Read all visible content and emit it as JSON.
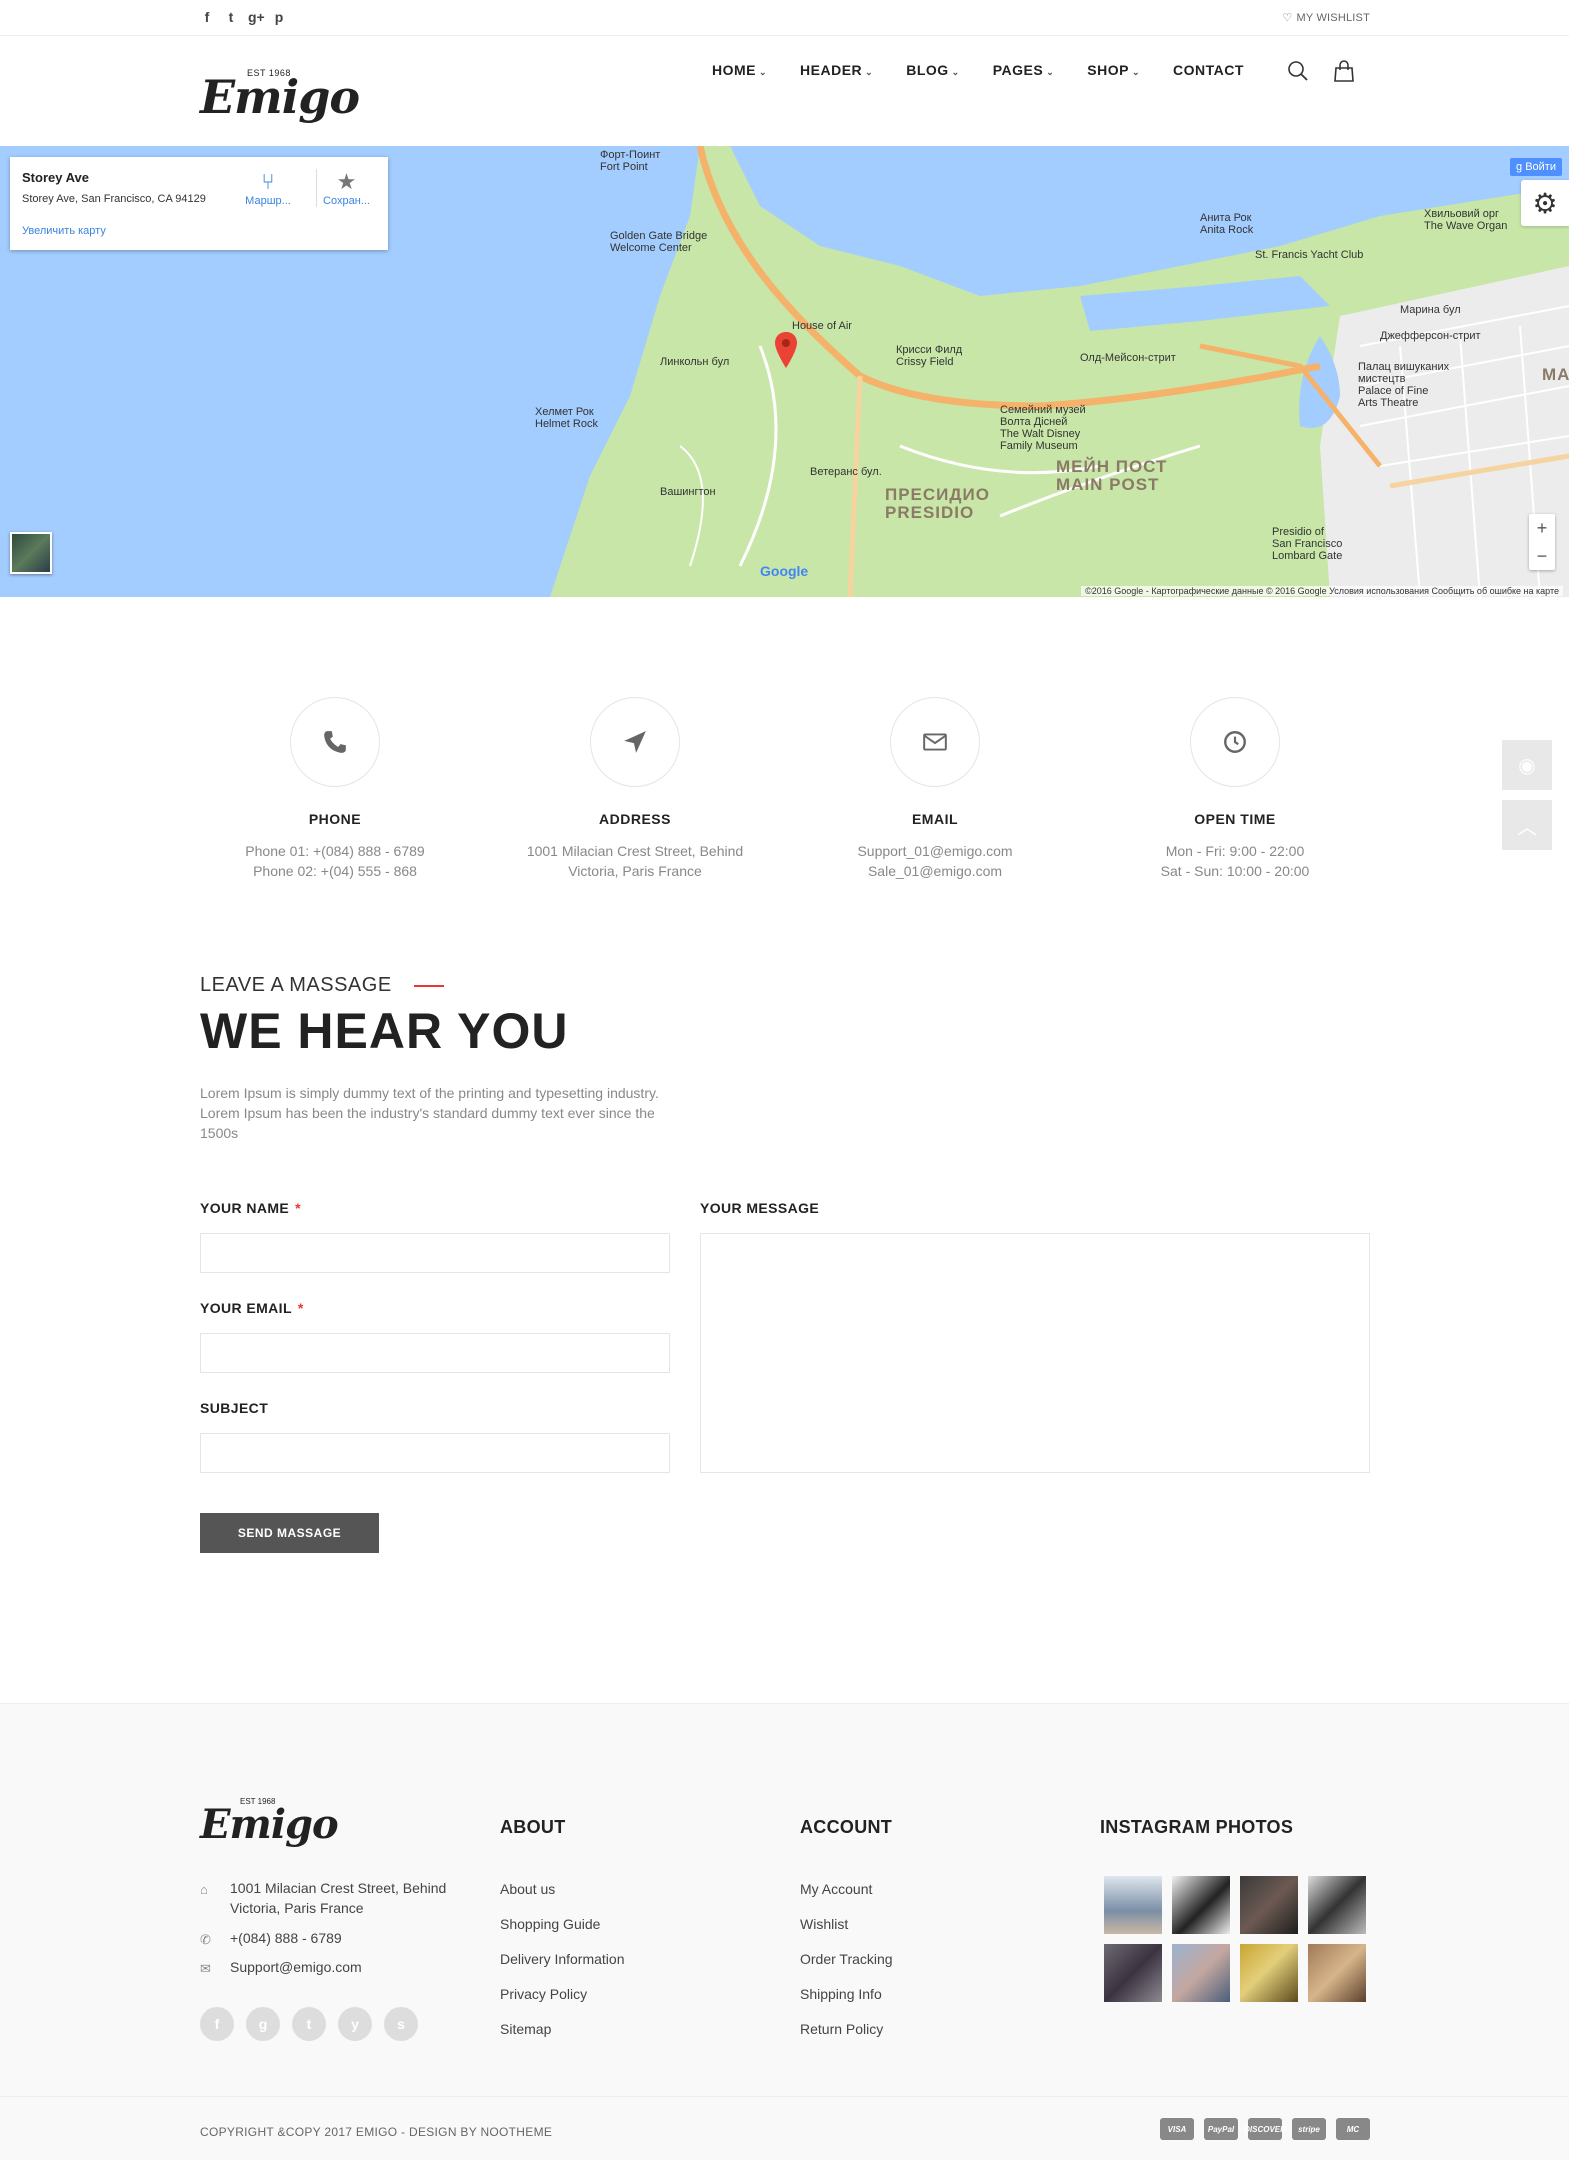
{
  "topbar": {
    "socials": [
      "f",
      "t",
      "g+",
      "p"
    ],
    "wishlist": "MY WISHLIST"
  },
  "header": {
    "logo_est": "EST 1968",
    "logo_word": "Emigo",
    "nav": [
      "HOME",
      "HEADER",
      "BLOG",
      "PAGES",
      "SHOP",
      "CONTACT"
    ]
  },
  "map": {
    "place_title": "Storey Ave",
    "place_address": "Storey Ave, San Francisco, CA 94129",
    "enlarge": "Увеличить карту",
    "route": "Маршр...",
    "save": "Сохран...",
    "signin": "Войти",
    "google": "Google",
    "attribution": "©2016 Google - Картографические данные © 2016 Google   Условия использования   Сообщить об ошибке на карте",
    "labels": {
      "fort_point": "Форт-Поинт\nFort Point",
      "golden_gate": "Golden Gate Bridge\nWelcome Center",
      "house_of_air": "House of Air",
      "crissy": "Крисси Филд\nCrissy Field",
      "helmet": "Хелмет Рок\nHelmet Rock",
      "presidio": "ПРЕСИДИО\nPRESIDIO",
      "main_post": "МЕЙН ПОСТ\nMAIN POST",
      "walt": "Семейний музей\nВолта Дісней\nThe Walt Disney\nFamily Museum",
      "anita": "Анита Рок\nAnita Rock",
      "yacht": "St. Francis Yacht Club",
      "palace": "Палац вишуканих\nмистецтв\nPalace of Fine\nArts Theatre",
      "lombard": "Presidio of\nSan Francisco\nLombard Gate",
      "wave": "Хвильовий орг\nThe Wave Organ",
      "marina": "Марина бул",
      "jefferson": "Джефферсон-стрит",
      "old_mason": "Олд-Мейсон-стрит",
      "veterans": "Ветеранс бул.",
      "lincoln": "Линкольн бул",
      "washington": "Вашингтон",
      "ma": "MA"
    }
  },
  "info": [
    {
      "label": "PHONE",
      "lines": [
        "Phone 01: +(084) 888 - 6789",
        "Phone 02: +(04) 555 - 868"
      ]
    },
    {
      "label": "ADDRESS",
      "lines": [
        "1001 Milacian Crest Street, Behind",
        "Victoria, Paris France"
      ]
    },
    {
      "label": "EMAIL",
      "lines": [
        "Support_01@emigo.com",
        "Sale_01@emigo.com"
      ]
    },
    {
      "label": "OPEN TIME",
      "lines": [
        "Mon - Fri: 9:00 - 22:00",
        "Sat - Sun: 10:00 - 20:00"
      ]
    }
  ],
  "form": {
    "kicker": "LEAVE A MASSAGE",
    "title": "WE HEAR YOU",
    "lorem": "Lorem Ipsum is simply dummy text of the printing and typesetting industry. Lorem Ipsum has been the industry's standard dummy text ever since the 1500s",
    "name_label": "YOUR NAME",
    "email_label": "YOUR EMAIL",
    "subject_label": "SUBJECT",
    "message_label": "YOUR MESSAGE",
    "required_mark": "*",
    "send": "SEND MASSAGE"
  },
  "footer": {
    "logo_est": "EST 1968",
    "logo_word": "Emigo",
    "address": "1001 Milacian Crest Street, Behind Victoria, Paris France",
    "phone": "+(084) 888 - 6789",
    "email": "Support@emigo.com",
    "socials": [
      "f",
      "g",
      "t",
      "y",
      "s"
    ],
    "about_title": "ABOUT",
    "about_links": [
      "About us",
      "Shopping Guide",
      "Delivery Information",
      "Privacy Policy",
      "Sitemap"
    ],
    "account_title": "ACCOUNT",
    "account_links": [
      "My Account",
      "Wishlist",
      "Order Tracking",
      "Shipping Info",
      "Return Policy"
    ],
    "instagram_title": "INSTAGRAM PHOTOS",
    "copyright": "COPYRIGHT &COPY 2017 EMIGO - DESIGN BY NOOTHEME",
    "payments": [
      "VISA",
      "PayPal",
      "DISCOVER",
      "stripe",
      "MC"
    ]
  },
  "colors": {
    "accent": "#e33333",
    "map_water": "#a3ccff",
    "map_land": "#c8e6a8",
    "button": "#555555"
  }
}
